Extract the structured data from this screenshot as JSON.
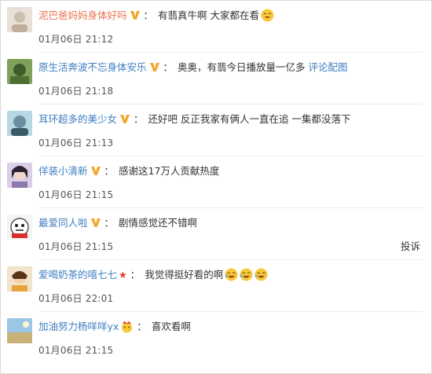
{
  "comments": [
    {
      "user": "泥巴爸妈妈身体好吗",
      "text": "有翡真牛啊 大家都在看",
      "time": "01月06日 21:12"
    },
    {
      "user": "原生活奔波不忘身体安乐",
      "text": "奥奥，有翡今日播放量一亿多",
      "link": "评论配图",
      "time": "01月06日 21:18"
    },
    {
      "user": "耳环超多的美少女",
      "text": "还好吧 反正我家有俩人一直在追 一集都没落下",
      "time": "01月06日 21:13"
    },
    {
      "user": "佯装小清新",
      "text": "感谢这17万人贡献热度",
      "time": "01月06日 21:15"
    },
    {
      "user": "最爱同人啦",
      "text": "剧情感觉还不错啊",
      "time": "01月06日 21:15",
      "action": "投诉"
    },
    {
      "user": "爱喝奶茶的嘻七七",
      "text": "我觉得挺好看的啊",
      "time": "01月06日 22:01"
    },
    {
      "user": "加油努力杨咩咩yx",
      "text": "喜欢看啊",
      "time": "01月06日 21:15"
    }
  ],
  "colors": {
    "username": "#eb7350",
    "link": "#3f7ec0",
    "badge": "#f3a52a",
    "star": "#e23a28"
  },
  "icons": {
    "verified": "v-badge-icon",
    "emoji": "laughing-face-icon",
    "star": "red-star-icon",
    "crown": "crown-emoji-icon"
  }
}
